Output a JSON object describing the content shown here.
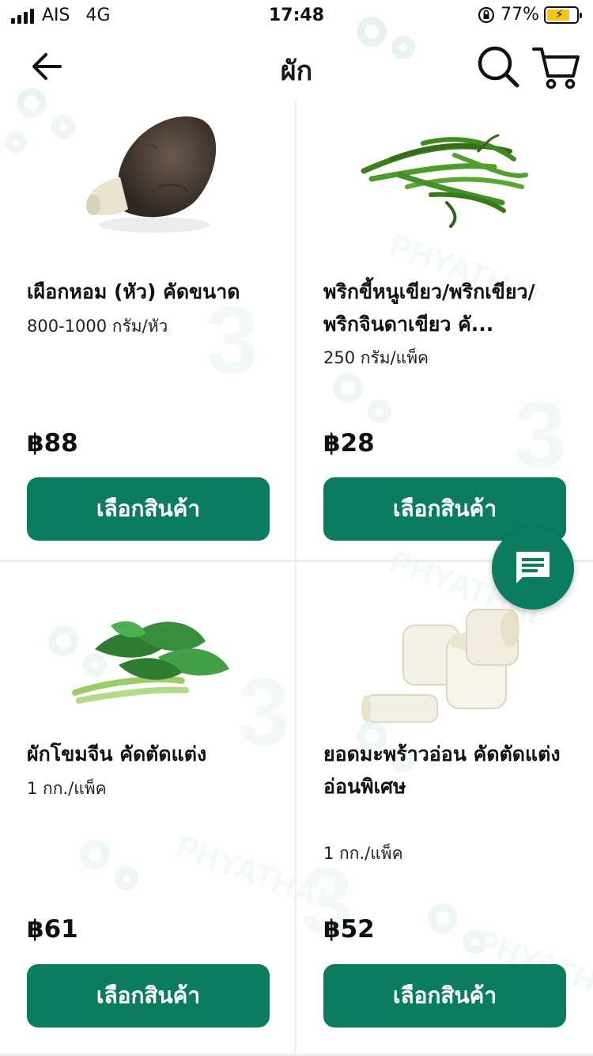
{
  "status_bar": {
    "carrier": "AIS",
    "network": "4G",
    "time": "17:48",
    "battery": "77%",
    "battery_level": 0.77
  },
  "header": {
    "title": "ผัก"
  },
  "colors": {
    "accent": "#0b7c5f",
    "divider": "#eeeeee"
  },
  "icons": {
    "back": "arrow-left-icon",
    "search": "search-icon",
    "cart": "cart-icon",
    "chat": "chat-icon"
  },
  "products": [
    {
      "name": "เผือกหอม (หัว) คัดขนาด",
      "unit": "800-1000 กรัม/หัว",
      "price": "฿88",
      "button_label": "เลือกสินค้า",
      "image": "taro-image"
    },
    {
      "name": "พริกขี้หนูเขียว/พริกเขียว/พริกจินดาเขียว คั...",
      "unit": "250 กรัม/แพ็ค",
      "price": "฿28",
      "button_label": "เลือกสินค้า",
      "image": "green-chili-image"
    },
    {
      "name": "ผักโขมจีน คัดตัดแต่ง",
      "unit": "1 กก./แพ็ค",
      "price": "฿61",
      "button_label": "เลือกสินค้า",
      "image": "chinese-spinach-image"
    },
    {
      "name": "ยอดมะพร้าวอ่อน คัดตัดแต่ง อ่อนพิเศษ",
      "unit": "1 กก./แพ็ค",
      "price": "฿52",
      "button_label": "เลือกสินค้า",
      "image": "coconut-shoot-image"
    }
  ]
}
